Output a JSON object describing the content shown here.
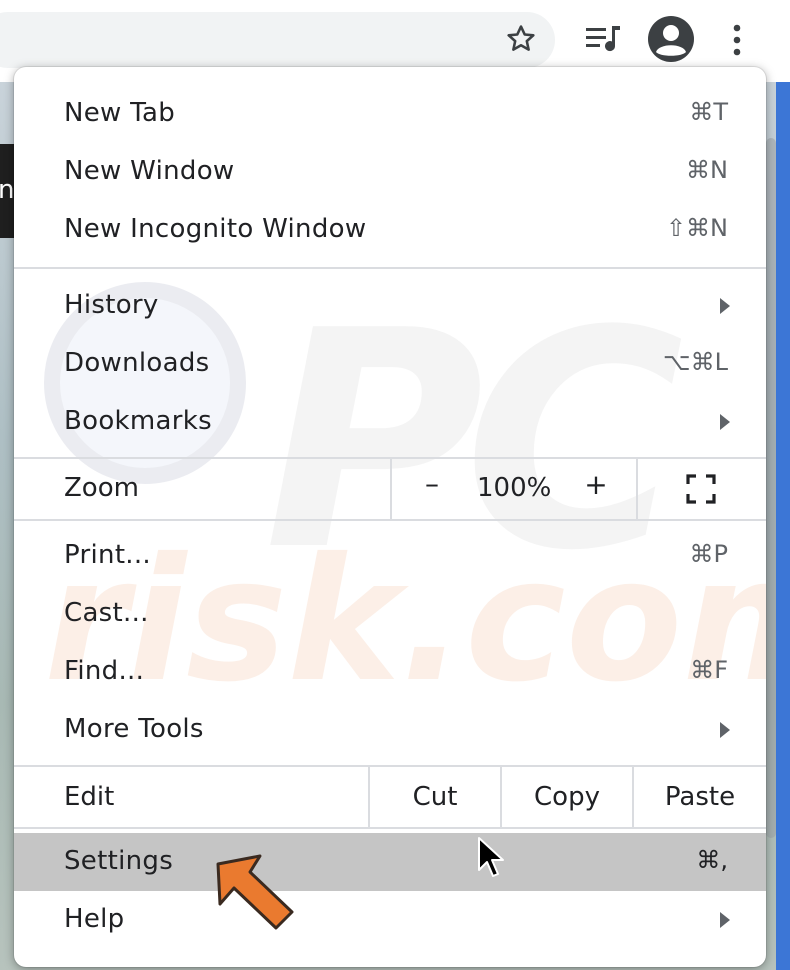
{
  "toolbar": {
    "icons": [
      "star-icon",
      "media-queue-icon",
      "account-avatar-icon",
      "more-menu-icon"
    ]
  },
  "background": {
    "left_letter": "n"
  },
  "menu": {
    "items_top": [
      {
        "label": "New Tab",
        "shortcut": "⌘T"
      },
      {
        "label": "New Window",
        "shortcut": "⌘N"
      },
      {
        "label": "New Incognito Window",
        "shortcut": "⇧⌘N"
      }
    ],
    "items_mid": [
      {
        "label": "History",
        "submenu": true
      },
      {
        "label": "Downloads",
        "shortcut": "⌥⌘L"
      },
      {
        "label": "Bookmarks",
        "submenu": true
      }
    ],
    "zoom": {
      "label": "Zoom",
      "minus": "–",
      "value": "100%",
      "plus": "+"
    },
    "items_tools": [
      {
        "label": "Print...",
        "shortcut": "⌘P"
      },
      {
        "label": "Cast..."
      },
      {
        "label": "Find...",
        "shortcut": "⌘F"
      },
      {
        "label": "More Tools",
        "submenu": true
      }
    ],
    "edit": {
      "label": "Edit",
      "cut": "Cut",
      "copy": "Copy",
      "paste": "Paste"
    },
    "items_bottom": [
      {
        "label": "Settings",
        "shortcut": "⌘,",
        "highlighted": true
      },
      {
        "label": "Help",
        "submenu": true
      }
    ]
  },
  "watermark": {
    "line1": "PC",
    "line2": "risk.com"
  },
  "colors": {
    "highlight": "#c5c5c5",
    "accent_arrow": "#ea7a2f",
    "text": "#202124"
  }
}
